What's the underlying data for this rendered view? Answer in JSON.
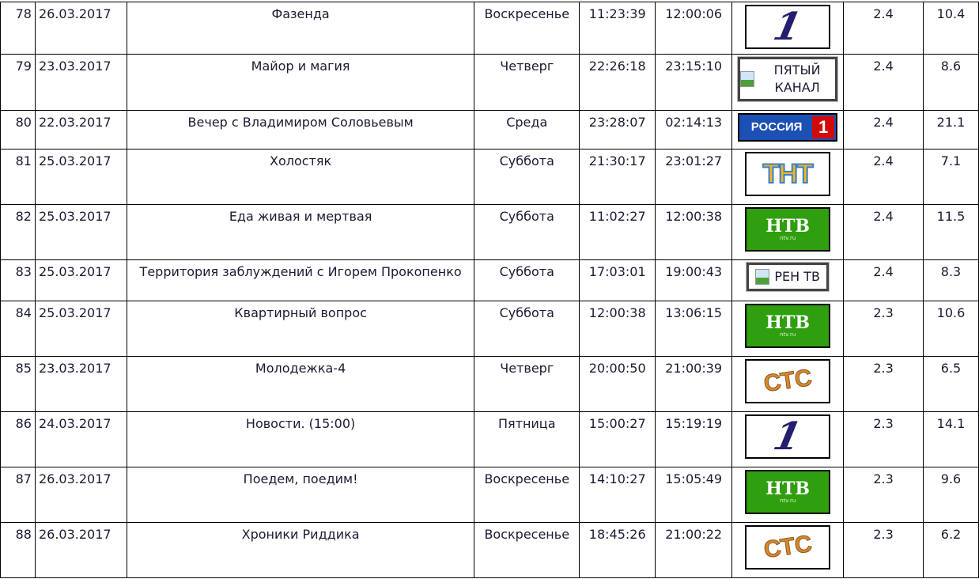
{
  "rows": [
    {
      "num": "78",
      "date": "26.03.2017",
      "title": "Фазенда",
      "day": "Воскресенье",
      "start": "11:23:39",
      "end": "12:00:06",
      "channel": {
        "logo": "perviy",
        "name": "1"
      },
      "rating": "2.4",
      "share": "10.4"
    },
    {
      "num": "79",
      "date": "23.03.2017",
      "title": "Майор и магия",
      "day": "Четверг",
      "start": "22:26:18",
      "end": "23:15:10",
      "channel": {
        "logo": "broken",
        "name": "ПЯТЫЙ КАНАЛ"
      },
      "rating": "2.4",
      "share": "8.6"
    },
    {
      "num": "80",
      "date": "22.03.2017",
      "title": "Вечер с Владимиром Соловьевым",
      "day": "Среда",
      "start": "23:28:07",
      "end": "02:14:13",
      "channel": {
        "logo": "russia",
        "name": "РОССИЯ",
        "badge": "1"
      },
      "rating": "2.4",
      "share": "21.1"
    },
    {
      "num": "81",
      "date": "25.03.2017",
      "title": "Холостяк",
      "day": "Суббота",
      "start": "21:30:17",
      "end": "23:01:27",
      "channel": {
        "logo": "tnt",
        "name": "ТНТ"
      },
      "rating": "2.4",
      "share": "7.1"
    },
    {
      "num": "82",
      "date": "25.03.2017",
      "title": "Еда живая и мертвая",
      "day": "Суббота",
      "start": "11:02:27",
      "end": "12:00:38",
      "channel": {
        "logo": "ntv",
        "name": "НТВ",
        "sub": "ntv.ru"
      },
      "rating": "2.4",
      "share": "11.5"
    },
    {
      "num": "83",
      "date": "25.03.2017",
      "title": "Территория заблуждений с Игорем Прокопенко",
      "day": "Суббота",
      "start": "17:03:01",
      "end": "19:00:43",
      "channel": {
        "logo": "broken-ren",
        "name": "РЕН ТВ"
      },
      "rating": "2.4",
      "share": "8.3"
    },
    {
      "num": "84",
      "date": "25.03.2017",
      "title": "Квартирный вопрос",
      "day": "Суббота",
      "start": "12:00:38",
      "end": "13:06:15",
      "channel": {
        "logo": "ntv",
        "name": "НТВ",
        "sub": "ntv.ru"
      },
      "rating": "2.3",
      "share": "10.6"
    },
    {
      "num": "85",
      "date": "23.03.2017",
      "title": "Молодежка-4",
      "day": "Четверг",
      "start": "20:00:50",
      "end": "21:00:39",
      "channel": {
        "logo": "sts",
        "name": "СТС"
      },
      "rating": "2.3",
      "share": "6.5"
    },
    {
      "num": "86",
      "date": "24.03.2017",
      "title": "Новости. (15:00)",
      "day": "Пятница",
      "start": "15:00:27",
      "end": "15:19:19",
      "channel": {
        "logo": "perviy",
        "name": "1"
      },
      "rating": "2.3",
      "share": "14.1"
    },
    {
      "num": "87",
      "date": "26.03.2017",
      "title": "Поедем, поедим!",
      "day": "Воскресенье",
      "start": "14:10:27",
      "end": "15:05:49",
      "channel": {
        "logo": "ntv",
        "name": "НТВ",
        "sub": "ntv.ru"
      },
      "rating": "2.3",
      "share": "9.6"
    },
    {
      "num": "88",
      "date": "26.03.2017",
      "title": "Хроники Риддика",
      "day": "Воскресенье",
      "start": "18:45:26",
      "end": "21:00:22",
      "channel": {
        "logo": "sts",
        "name": "СТС"
      },
      "rating": "2.3",
      "share": "6.2"
    }
  ]
}
